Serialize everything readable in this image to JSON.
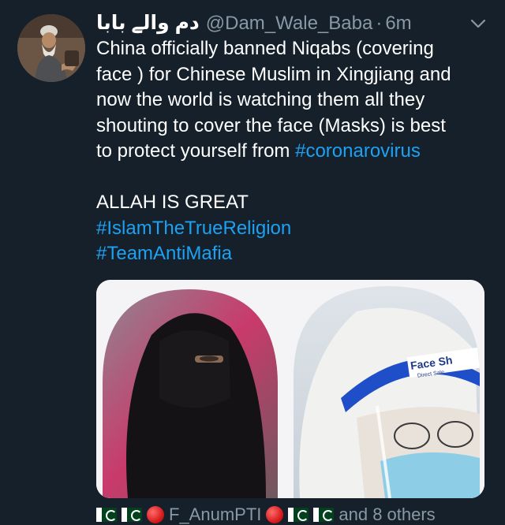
{
  "tweet": {
    "display_name": "دم والے بابا",
    "handle": "@Dam_Wale_Baba",
    "separator": "·",
    "time": "6m",
    "body_lines": [
      "China officially banned Niqabs (covering",
      "face ) for Chinese Muslim in Xingjiang and",
      "now the world is watching them all they",
      "shouting to cover the face (Masks) is best"
    ],
    "body_last_prefix": "to protect yourself from ",
    "body_hashtag": "#coronarovirus",
    "exclaim": "ALLAH IS GREAT",
    "hashtags": [
      "#IslamTheTrueReligion",
      "#TeamAntiMafia"
    ]
  },
  "media": {
    "shield_label": "Face Sh",
    "shield_sub": "Direct Sale"
  },
  "liked_by": {
    "user": "F_AnumPTI",
    "others": "and 8 others"
  },
  "icons": {
    "menu": "chevron-down-icon",
    "flag": "pakistan-flag-icon",
    "red_circle": "red-circle-icon"
  },
  "colors": {
    "background": "#15202b",
    "text": "#ffffff",
    "muted": "#8899a6",
    "link": "#1da1f2"
  }
}
